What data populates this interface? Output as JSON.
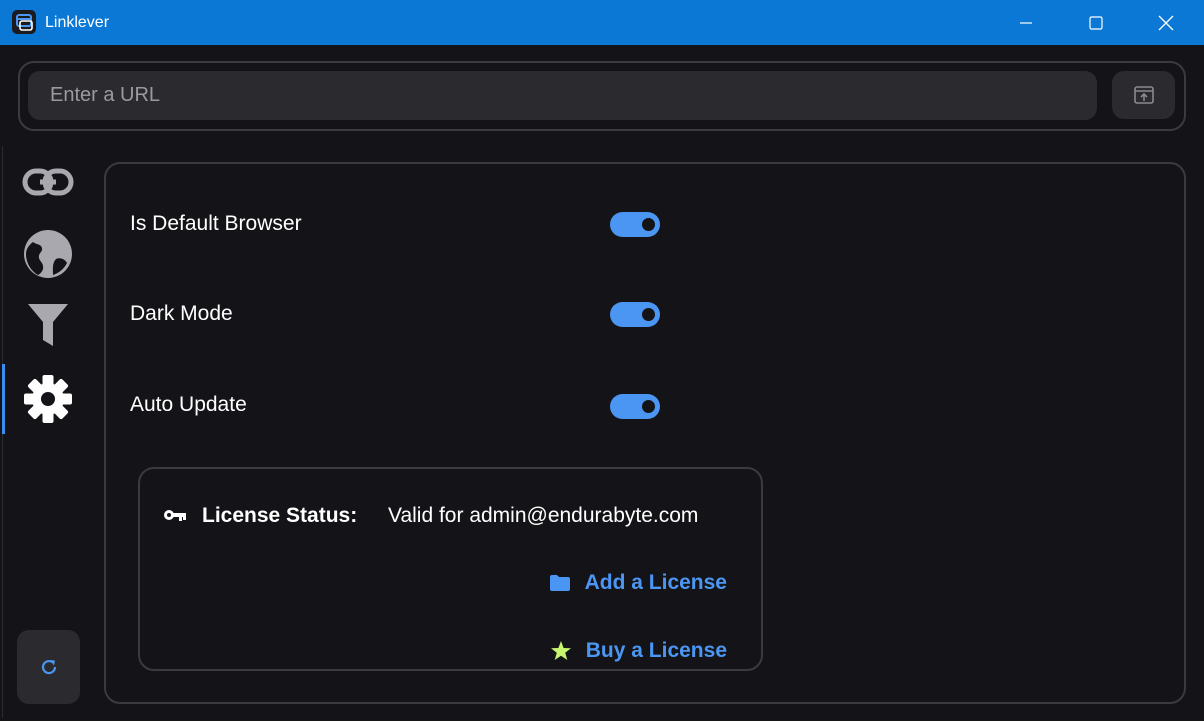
{
  "window": {
    "title": "Linklever"
  },
  "url_bar": {
    "placeholder": "Enter a URL"
  },
  "sidebar": {
    "items": [
      {
        "name": "links",
        "icon": "link-icon"
      },
      {
        "name": "browsers",
        "icon": "globe-icon"
      },
      {
        "name": "filters",
        "icon": "filter-icon"
      },
      {
        "name": "settings",
        "icon": "gear-icon",
        "active": true
      }
    ],
    "refresh_icon": "refresh-icon"
  },
  "settings": {
    "default_browser": {
      "label": "Is Default Browser",
      "enabled": true
    },
    "dark_mode": {
      "label": "Dark Mode",
      "enabled": true
    },
    "auto_update": {
      "label": "Auto Update",
      "enabled": true
    }
  },
  "license": {
    "status_label": "License Status:",
    "status_value": "Valid for admin@endurabyte.com",
    "add_label": "Add a License",
    "buy_label": "Buy a License"
  },
  "colors": {
    "titlebar": "#0a78d4",
    "accent": "#4b96f3",
    "background": "#141418",
    "surface": "#2a2a2f",
    "border": "#3a3a40",
    "star": "#c8f56e"
  }
}
